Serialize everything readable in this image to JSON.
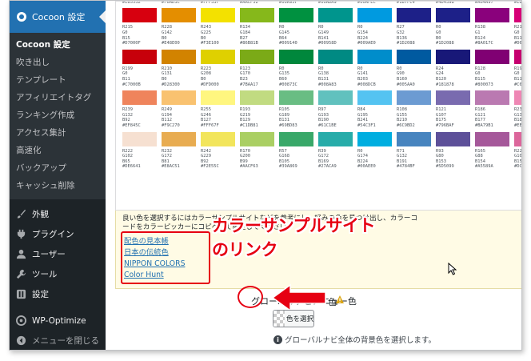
{
  "sidebar": {
    "header_label": "Cocoon 設定",
    "submenu": [
      "Cocoon 設定",
      "吹き出し",
      "テンプレート",
      "アフィリエイトタグ",
      "ランキング作成",
      "アクセス集計",
      "高速化",
      "バックアップ",
      "キャッシュ削除"
    ],
    "menu": [
      {
        "label": "外観",
        "icon": "paintbrush-icon"
      },
      {
        "label": "プラグイン",
        "icon": "plugin-icon"
      },
      {
        "label": "ユーザー",
        "icon": "user-icon"
      },
      {
        "label": "ツール",
        "icon": "wrench-icon"
      },
      {
        "label": "設定",
        "icon": "settings-icon"
      }
    ],
    "wp_optimize": "WP-Optimize",
    "collapse": "メニューを閉じる"
  },
  "palette": {
    "rows": [
      [
        {
          "color": "#E85532",
          "text": "R232\nG85\nB50\n#E85532"
        },
        {
          "color": "#F6AD3C",
          "text": "R246\nG173\nB60\n#F6AD3C"
        },
        {
          "color": "#FFF33F",
          "text": "R255\nG243\nB63\n#FFF33F"
        },
        {
          "color": "#AACF52",
          "text": "R170\nG207\nB82\n#AACF52"
        },
        {
          "color": "#00A95F",
          "text": "R0\nG169\nB95\n#00A95F"
        },
        {
          "color": "#00ADA9",
          "text": "R0\nG173\nB169\n#00ADA9"
        },
        {
          "color": "#00AFEC",
          "text": "R0\nG175\nB236\n#00AFEC"
        },
        {
          "color": "#187FC4",
          "text": "R24\nG127\nB196\n#187FC4"
        },
        {
          "color": "#4D4398",
          "text": "R77\nG67\nB152\n#4D4398"
        },
        {
          "color": "#A64A97",
          "text": "R166\nG74\nB151\n#A64A97"
        },
        {
          "color": "#E85298",
          "text": "R232\nG82\nB152\n#E85298"
        },
        {
          "color": "#E9546B",
          "text": "R233\nG84\nB107\n#E9546B"
        }
      ],
      [
        {
          "color": "#D7000F",
          "text": "R215\nG0\nB15\n#D7000F"
        },
        {
          "color": "#E48E00",
          "text": "R228\nG142\nB0\n#E48E00"
        },
        {
          "color": "#F3E100",
          "text": "R243\nG225\nB0\n#F3E100"
        },
        {
          "color": "#86B81B",
          "text": "R134\nG184\nB27\n#86B81B"
        },
        {
          "color": "#009140",
          "text": "R0\nG145\nB64\n#009140"
        },
        {
          "color": "#00958D",
          "text": "R0\nG149\nB141\n#00958D"
        },
        {
          "color": "#009AE0",
          "text": "R0\nG154\nB224\n#009AE0"
        },
        {
          "color": "#1D2088",
          "text": "R27\nG32\nB136\n#1D2088"
        },
        {
          "color": "#1D2088",
          "text": "R0\nG0\nB0\n#1D2088"
        },
        {
          "color": "#8A017C",
          "text": "R138\nG1\nB124\n#8A017C"
        },
        {
          "color": "#D60077",
          "text": "R214\nG0\nB119\n#D60077"
        },
        {
          "color": "#D7004A",
          "text": "R215\nG0\nB74\n#D7004A"
        }
      ],
      [
        {
          "color": "#C7000B",
          "text": "R199\nG0\nB11\n#C7000B"
        },
        {
          "color": "#D28300",
          "text": "R210\nG131\nB0\n#D28300"
        },
        {
          "color": "#DFD000",
          "text": "R223\nG208\nB0\n#DFD000"
        },
        {
          "color": "#7BAA17",
          "text": "R123\nG170\nB23\n#7BAA17"
        },
        {
          "color": "#00873C",
          "text": "R0\nG135\nB60\n#00873C"
        },
        {
          "color": "#008A83",
          "text": "R0\nG138\nB131\n#008A83"
        },
        {
          "color": "#008DCB",
          "text": "R0\nG141\nB203\n#008DCB"
        },
        {
          "color": "#005AA0",
          "text": "R0\nG90\nB160\n#005AA0"
        },
        {
          "color": "#181878",
          "text": "R24\nG24\nB120\n#181878"
        },
        {
          "color": "#800073",
          "text": "R128\nG0\nB115\n#800073"
        },
        {
          "color": "#C6006F",
          "text": "R198\nG0\nB111\n#C6006F"
        },
        {
          "color": "#C70044",
          "text": "R199\nG0\nB68\n#C70044"
        }
      ],
      [
        {
          "color": "#EF845C",
          "text": "R239\nG132\nB92\n#EF845C"
        },
        {
          "color": "#F9C270",
          "text": "R249\nG194\nB112\n#F9C270"
        },
        {
          "color": "#FFF67F",
          "text": "R255\nG246\nB127\n#FFF67F"
        },
        {
          "color": "#C1DB81",
          "text": "R193\nG219\nB129\n#C1DB81"
        },
        {
          "color": "#69BD83",
          "text": "R105\nG189\nB131\n#69BD83"
        },
        {
          "color": "#61C1BE",
          "text": "R97\nG193\nB190\n#61C1BE"
        },
        {
          "color": "#54C3F1",
          "text": "R84\nG195\nB241\n#54C3F1"
        },
        {
          "color": "#6C9BD2",
          "text": "R108\nG155\nB210\n#6C9BD2"
        },
        {
          "color": "#796BAF",
          "text": "R121\nG107\nB175\n#796BAF"
        },
        {
          "color": "#BA79B1",
          "text": "R186\nG121\nB177\n#BA79B1"
        },
        {
          "color": "#EE87B4",
          "text": "R238\nG135\nB180\n#EE87B4"
        },
        {
          "color": "#EF858C",
          "text": "R239\nG133\nB140\n#EF858C"
        }
      ],
      [
        {
          "color": "#F6E0D1",
          "text": "R222\nG102\nB65\n#DE6641"
        },
        {
          "color": "#E8AC51",
          "text": "R232\nG172\nB81\n#E8AC51"
        },
        {
          "color": "#F2E55C",
          "text": "R242\nG229\nB92\n#F2E55C"
        },
        {
          "color": "#AACF63",
          "text": "R170\nG200\nB99\n#AACF63"
        },
        {
          "color": "#39A869",
          "text": "R57\nG168\nB105\n#39A869"
        },
        {
          "color": "#27ACA9",
          "text": "R39\nG172\nB169\n#27ACA9"
        },
        {
          "color": "#00AEE0",
          "text": "R0\nG174\nB224\n#00AEE0"
        },
        {
          "color": "#4784BF",
          "text": "R71\nG132\nB191\n#4784BF"
        },
        {
          "color": "#5D5099",
          "text": "R93\nG80\nB153\n#5D5099"
        },
        {
          "color": "#A5589A",
          "text": "R165\nG88\nB154\n#A5589A"
        },
        {
          "color": "#DC669B",
          "text": "R220\nG102\nB155\n#DC669B"
        },
        {
          "color": "#DD6673",
          "text": "R221\nG102\nB115\n#DD6673"
        }
      ]
    ]
  },
  "note": {
    "text_line1": "良い色を選択するにはカラーサンプルサイトなどを参考にし、好みの色を見つけ出し、カラーコ",
    "text_line2": "ードをカラーピッカーにコピペして設定してください。",
    "links": [
      "配色の見本帳",
      "日本の伝統色",
      "NIPPON COLORS",
      "Color Hunt"
    ]
  },
  "annotation": {
    "line1": "カラーサンプルサイト",
    "line2": "のリンク"
  },
  "setting": {
    "title": "グローバルナビメニュー色",
    "title_tail": "色",
    "button_label": "色を選択",
    "description": "グローバルナビ全体の背景色を選択します。"
  }
}
